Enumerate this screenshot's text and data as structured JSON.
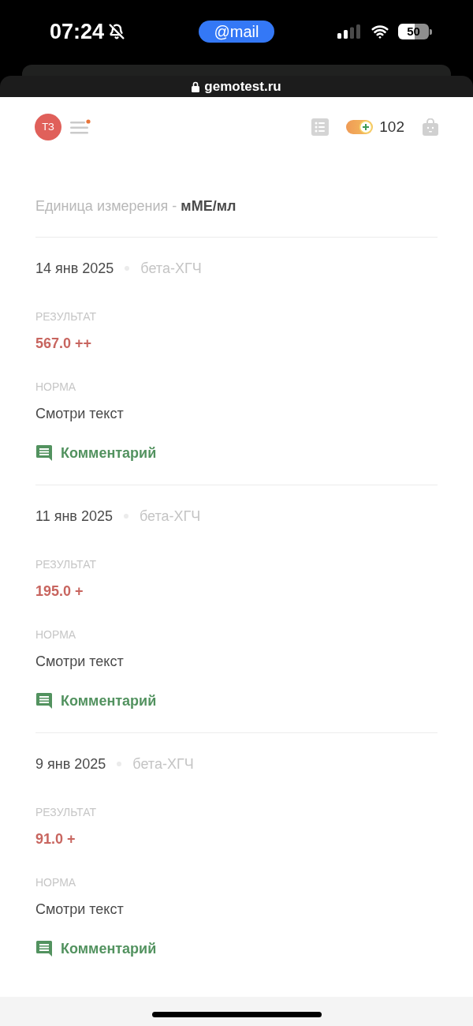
{
  "status_bar": {
    "time": "07:24",
    "silent": true,
    "app_pill": "@mail",
    "battery": "50"
  },
  "address_bar": {
    "secure": true,
    "domain": "gemotest.ru"
  },
  "header": {
    "avatar_initials": "ТЗ",
    "menu_notification": true,
    "bonus_points": "102"
  },
  "unit_line": "Единица измерения - **мМЕ/мл**",
  "entries": [
    {
      "date": "14 янв 2025",
      "test": "бета-ХГЧ",
      "result_label": "РЕЗУЛЬТАТ",
      "result": "567.0 ++",
      "abnormal": true,
      "norm_label": "НОРМА",
      "norm": "Смотри текст",
      "comment": "Комментарий"
    },
    {
      "date": "11 янв 2025",
      "test": "бета-ХГЧ",
      "result_label": "РЕЗУЛЬТАТ",
      "result": "195.0 +",
      "abnormal": true,
      "norm_label": "НОРМА",
      "norm": "Смотри текст",
      "comment": "Комментарий"
    },
    {
      "date": "9 янв 2025",
      "test": "бета-ХГЧ",
      "result_label": "РЕЗУЛЬТАТ",
      "result": "91.0 +",
      "abnormal": true,
      "norm_label": "НОРМА",
      "norm": "Смотри текст",
      "comment": "Комментарий"
    }
  ]
}
